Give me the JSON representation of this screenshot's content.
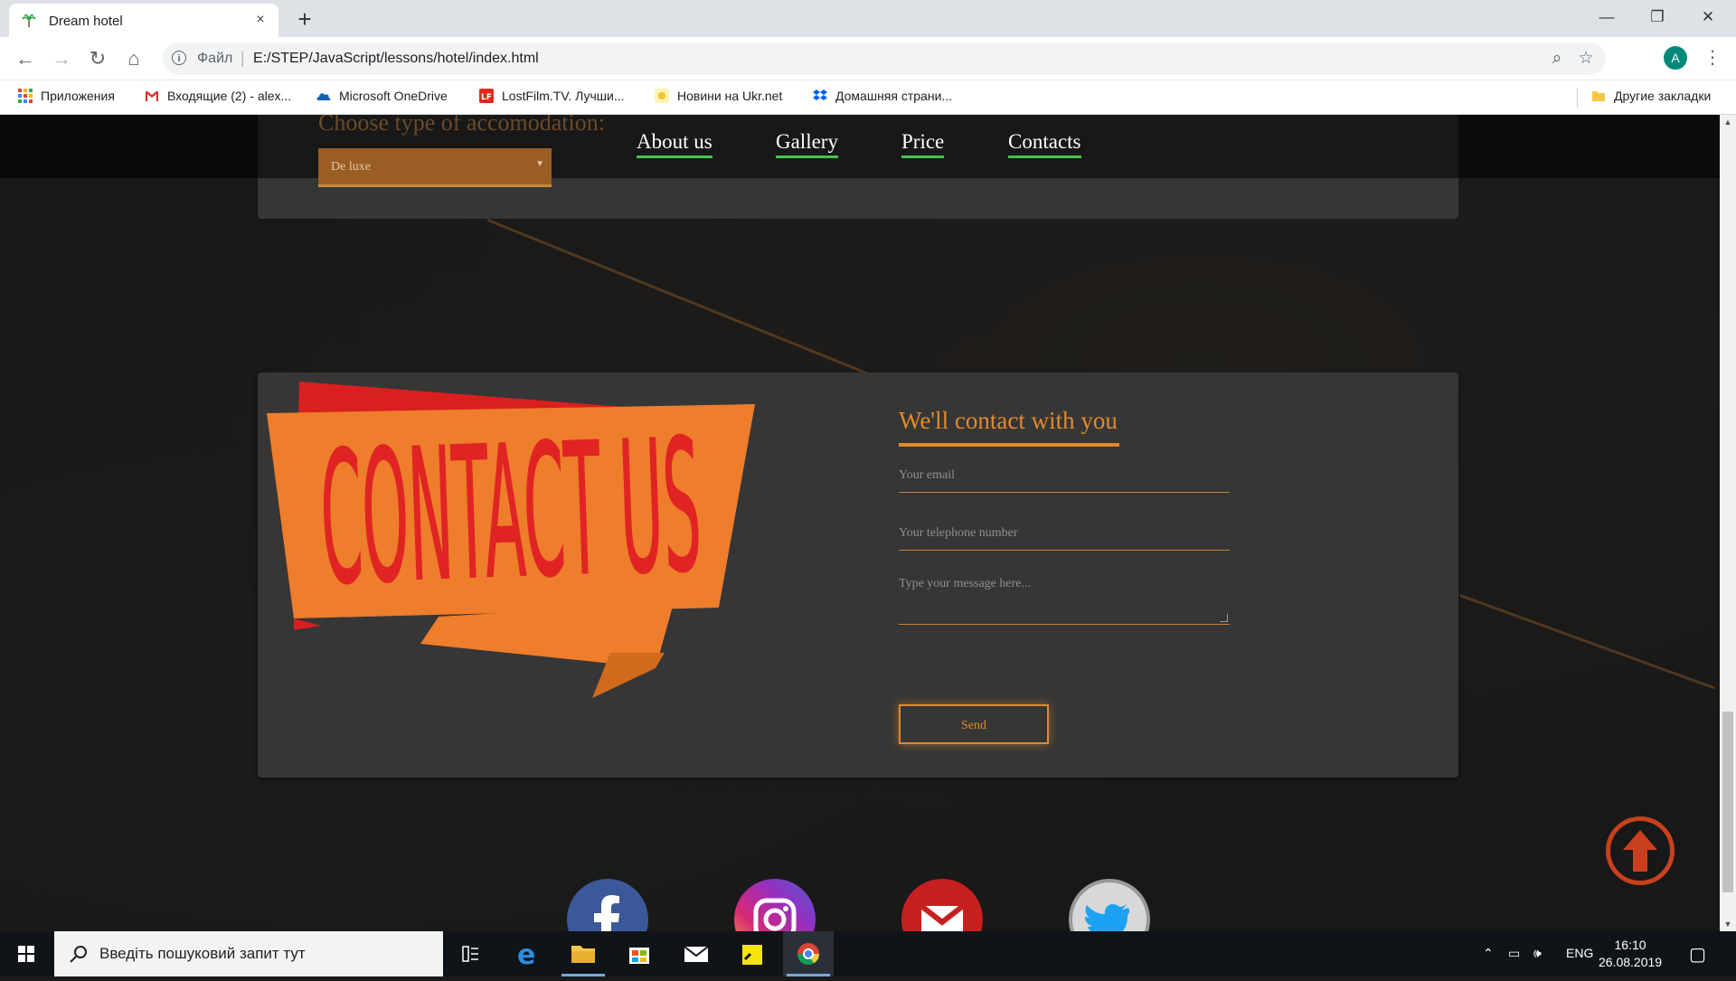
{
  "browser": {
    "tab_title": "Dream hotel",
    "tab_close_icon": "×",
    "new_tab_icon": "+",
    "window_controls": [
      "—",
      "❐",
      "✕"
    ],
    "scheme_label": "Файл",
    "url": "E:/STEP/JavaScript/lessons/hotel/index.html",
    "profile_initial": "A"
  },
  "bookmarks": [
    {
      "label": "Приложения",
      "icon": "apps-grid-icon"
    },
    {
      "label": "Входящие (2) - alex...",
      "icon": "gmail-icon"
    },
    {
      "label": "Microsoft OneDrive",
      "icon": "onedrive-icon"
    },
    {
      "label": "LostFilm.TV. Лучши...",
      "icon": "lostfilm-icon"
    },
    {
      "label": "Новини на Ukr.net",
      "icon": "ukrnet-icon"
    },
    {
      "label": "Домашняя страни...",
      "icon": "dropbox-icon"
    }
  ],
  "other_bookmarks": "Другие закладки",
  "page": {
    "choose_label": "Choose type of accomodation:",
    "select_value": "De luxe",
    "nav": [
      "About us",
      "Gallery",
      "Price",
      "Contacts"
    ],
    "banner_text": "CONTACT US",
    "form": {
      "title": "We'll contact with you",
      "email_placeholder": "Your email",
      "phone_placeholder": "Your telephone number",
      "message_placeholder": "Type your message here...",
      "send_label": "Send"
    },
    "social": [
      "facebook-icon",
      "instagram-icon",
      "gmail-icon",
      "twitter-icon"
    ]
  },
  "taskbar": {
    "search_placeholder": "Введіть пошуковий запит тут",
    "language": "ENG",
    "time": "16:10",
    "date": "26.08.2019"
  },
  "colors": {
    "accent_orange": "#e08a2c",
    "nav_underline": "#46c24b",
    "up_arrow": "#c9401e"
  }
}
